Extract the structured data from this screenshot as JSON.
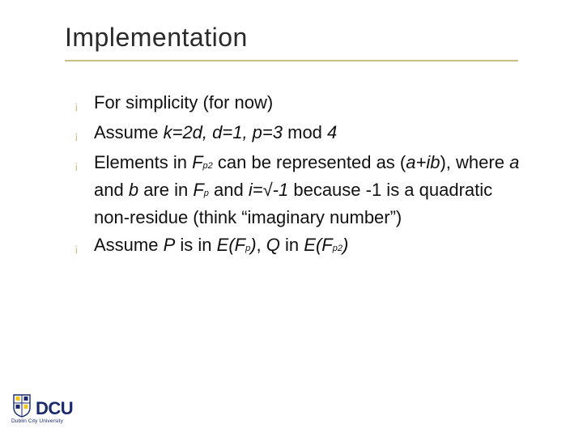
{
  "title": "Implementation",
  "bullets": [
    {
      "html": "For simplicity (for now)"
    },
    {
      "html": "Assume <i>k=2d, d=1, p=3</i> mod <i>4</i>"
    },
    {
      "html": "Elements in <i>F<sub>p2</sub></i> can be represented as (<i>a+ib</i>), where <i>a</i> and <i>b</i> are in <i>F<sub>p</sub></i> and <i>i=√-1</i> because -1 is a quadratic non-residue (think “imaginary number”)"
    },
    {
      "html": "Assume <i>P</i> is in <i>E(F<sub>p</sub>)</i>, <i>Q</i> in <i>E(F<sub>p2</sub>)</i>"
    }
  ],
  "bullet_marker": "¡",
  "logo": {
    "letters": "DCU",
    "subtitle": "Dublin City University"
  }
}
